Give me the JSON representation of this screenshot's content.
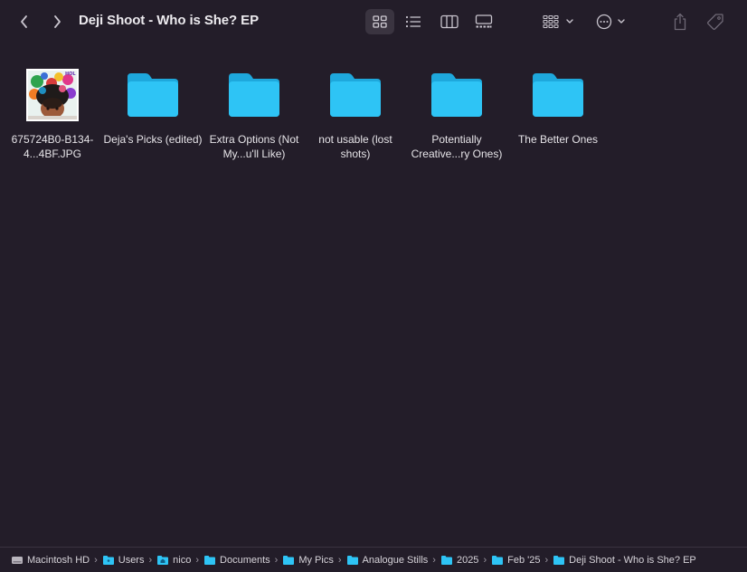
{
  "window": {
    "title": "Deji Shoot - Who is She? EP"
  },
  "toolbar": {
    "back_icon": "chevron-left-icon",
    "forward_icon": "chevron-right-icon",
    "views": [
      "icon-view",
      "list-view",
      "column-view",
      "gallery-view"
    ],
    "active_view": "icon-view"
  },
  "items": [
    {
      "label": "675724B0-B134-4...4BF.JPG",
      "kind": "image"
    },
    {
      "label": "Deja's Picks (edited)",
      "kind": "folder"
    },
    {
      "label": "Extra Options (Not My...u'll Like)",
      "kind": "folder"
    },
    {
      "label": "not usable (lost shots)",
      "kind": "folder"
    },
    {
      "label": "Potentially Creative...ry Ones)",
      "kind": "folder"
    },
    {
      "label": "The Better Ones",
      "kind": "folder"
    }
  ],
  "pathbar": {
    "crumbs": [
      "Macintosh HD",
      "Users",
      "nico",
      "Documents",
      "My Pics",
      "Analogue Stills",
      "2025",
      "Feb '25",
      "Deji Shoot - Who is She? EP"
    ]
  },
  "colors": {
    "background": "#231d29",
    "folder": "#2ec4f5",
    "folder_tab": "#1ea8dc"
  }
}
